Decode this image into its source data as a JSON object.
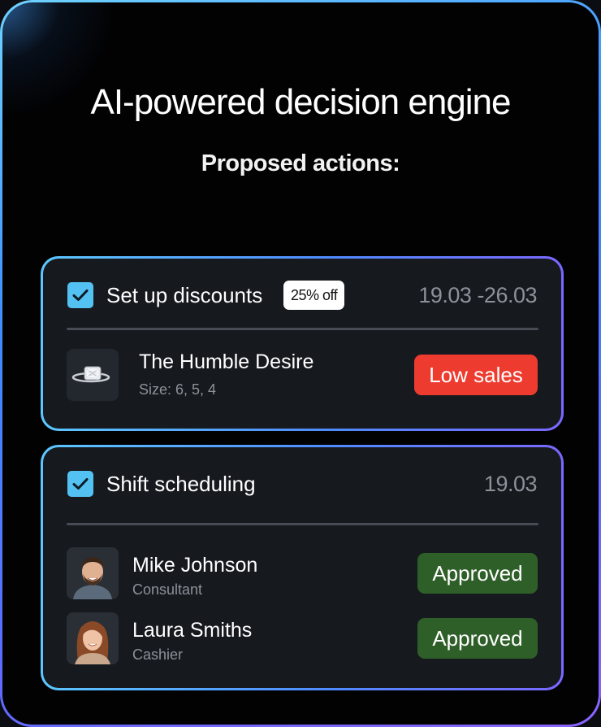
{
  "header": {
    "title": "AI-powered decision engine",
    "subtitle": "Proposed actions:"
  },
  "discounts_card": {
    "checked": true,
    "title": "Set up discounts",
    "badge": "25% off",
    "date_range": "19.03 -26.03",
    "product": {
      "name": "The Humble Desire",
      "sizes": "Size: 6, 5, 4",
      "status": "Low sales",
      "status_color": "#ee3b2f",
      "icon": "ring-icon"
    }
  },
  "shift_card": {
    "checked": true,
    "title": "Shift scheduling",
    "date": "19.03",
    "employees": [
      {
        "name": "Mike Johnson",
        "role": "Consultant",
        "status": "Approved",
        "status_color": "#2f5f28"
      },
      {
        "name": "Laura Smiths",
        "role": "Cashier",
        "status": "Approved",
        "status_color": "#2f5f28"
      }
    ]
  },
  "colors": {
    "accent_checkbox": "#53c2f2",
    "card_border_start": "#5cc7ff",
    "card_border_end": "#7a68ff",
    "background": "#020203"
  }
}
